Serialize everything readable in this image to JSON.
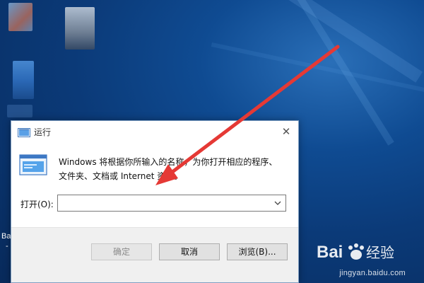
{
  "desktop": {
    "icon_label_1": "Ba",
    "icon_label_2": "-"
  },
  "dialog": {
    "title": "运行",
    "close_symbol": "✕",
    "description": "Windows 将根据你所输入的名称，为你打开相应的程序、文件夹、文档或 Internet 资源。",
    "open_label": "打开(O):",
    "open_value": "",
    "buttons": {
      "ok": "确定",
      "cancel": "取消",
      "browse": "浏览(B)..."
    },
    "icons": {
      "title": "run-icon",
      "main": "run-icon",
      "dropdown": "chevron-down-icon",
      "close": "close-icon"
    }
  },
  "overlay": {
    "annotation_color": "#e53935",
    "watermark_brand": "Bai 经验",
    "watermark_url": "jingyan.baidu.com"
  }
}
